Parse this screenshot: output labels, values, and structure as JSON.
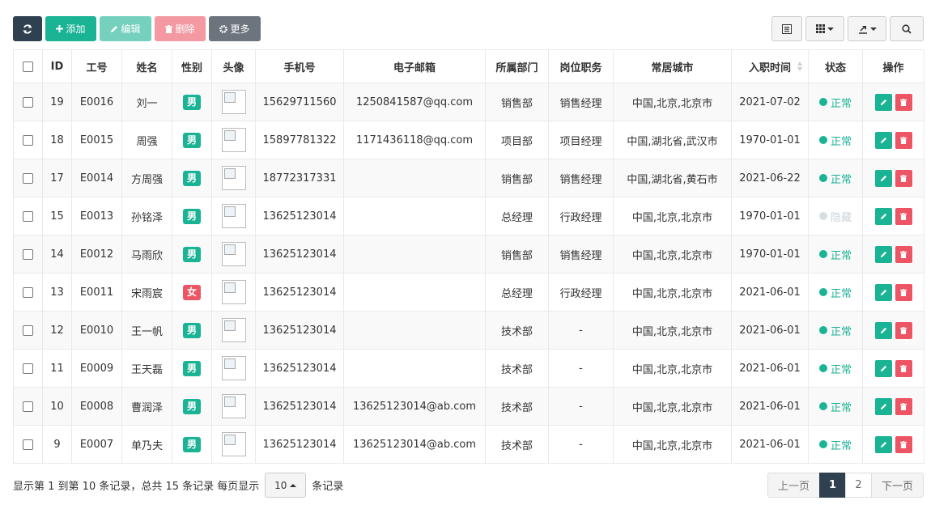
{
  "toolbar": {
    "refresh_icon": "refresh-icon",
    "add_label": "添加",
    "edit_label": "编辑",
    "delete_label": "删除",
    "more_label": "更多"
  },
  "right_tools": {
    "toggle_view_icon": "list-icon",
    "columns_icon": "grid-icon",
    "export_icon": "export-icon",
    "search_icon": "search-icon"
  },
  "table": {
    "headers": [
      "ID",
      "工号",
      "姓名",
      "性别",
      "头像",
      "手机号",
      "电子邮箱",
      "所属部门",
      "岗位职务",
      "常居城市",
      "入职时间",
      "状态",
      "操作"
    ],
    "rows": [
      {
        "id": "19",
        "code": "E0016",
        "name": "刘一",
        "gender": "男",
        "phone": "15629711560",
        "email": "1250841587@qq.com",
        "dept": "销售部",
        "post": "销售经理",
        "city": "中国,北京,北京市",
        "date": "2021-07-02",
        "status": "正常"
      },
      {
        "id": "18",
        "code": "E0015",
        "name": "周强",
        "gender": "男",
        "phone": "15897781322",
        "email": "1171436118@qq.com",
        "dept": "项目部",
        "post": "项目经理",
        "city": "中国,湖北省,武汉市",
        "date": "1970-01-01",
        "status": "正常"
      },
      {
        "id": "17",
        "code": "E0014",
        "name": "方周强",
        "gender": "男",
        "phone": "18772317331",
        "email": "",
        "dept": "销售部",
        "post": "销售经理",
        "city": "中国,湖北省,黄石市",
        "date": "2021-06-22",
        "status": "正常"
      },
      {
        "id": "15",
        "code": "E0013",
        "name": "孙铭泽",
        "gender": "男",
        "phone": "13625123014",
        "email": "",
        "dept": "总经理",
        "post": "行政经理",
        "city": "中国,北京,北京市",
        "date": "1970-01-01",
        "status": "隐藏"
      },
      {
        "id": "14",
        "code": "E0012",
        "name": "马雨欣",
        "gender": "男",
        "phone": "13625123014",
        "email": "",
        "dept": "销售部",
        "post": "销售经理",
        "city": "中国,北京,北京市",
        "date": "1970-01-01",
        "status": "正常"
      },
      {
        "id": "13",
        "code": "E0011",
        "name": "宋雨宸",
        "gender": "女",
        "phone": "13625123014",
        "email": "",
        "dept": "总经理",
        "post": "行政经理",
        "city": "中国,北京,北京市",
        "date": "2021-06-01",
        "status": "正常"
      },
      {
        "id": "12",
        "code": "E0010",
        "name": "王一帆",
        "gender": "男",
        "phone": "13625123014",
        "email": "",
        "dept": "技术部",
        "post": "-",
        "city": "中国,北京,北京市",
        "date": "2021-06-01",
        "status": "正常"
      },
      {
        "id": "11",
        "code": "E0009",
        "name": "王天磊",
        "gender": "男",
        "phone": "13625123014",
        "email": "",
        "dept": "技术部",
        "post": "-",
        "city": "中国,北京,北京市",
        "date": "2021-06-01",
        "status": "正常"
      },
      {
        "id": "10",
        "code": "E0008",
        "name": "曹润泽",
        "gender": "男",
        "phone": "13625123014",
        "email": "13625123014@ab.com",
        "dept": "技术部",
        "post": "-",
        "city": "中国,北京,北京市",
        "date": "2021-06-01",
        "status": "正常"
      },
      {
        "id": "9",
        "code": "E0007",
        "name": "单乃夫",
        "gender": "男",
        "phone": "13625123014",
        "email": "13625123014@ab.com",
        "dept": "技术部",
        "post": "-",
        "city": "中国,北京,北京市",
        "date": "2021-06-01",
        "status": "正常"
      }
    ]
  },
  "footer": {
    "info_prefix": "显示第 1 到第 10 条记录，总共 15 条记录 每页显示",
    "page_size": "10",
    "info_suffix": "条记录",
    "prev_label": "上一页",
    "pages": [
      "1",
      "2"
    ],
    "current_page": "1",
    "next_label": "下一页"
  },
  "colors": {
    "primary": "#1ab394",
    "danger": "#ed5565",
    "dark": "#2f4050",
    "muted": "#6c757d"
  }
}
